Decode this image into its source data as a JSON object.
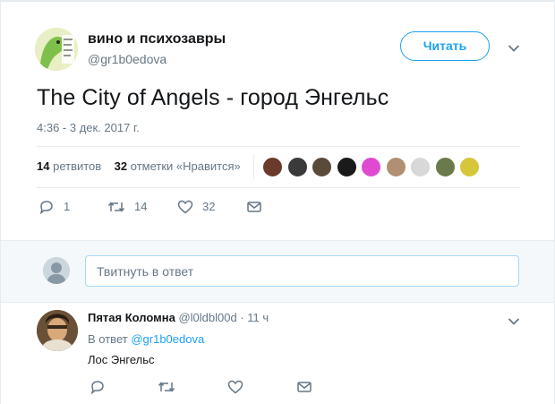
{
  "tweet": {
    "author_name": "вино и психозавры",
    "author_handle": "@gr1b0edova",
    "follow_label": "Читать",
    "text": "The City of Angels - город Энгельс",
    "timestamp": "4:36 - 3 дек. 2017 г.",
    "retweets_count": "14",
    "retweets_label": "ретвитов",
    "likes_count": "32",
    "likes_label": "отметки «Нравится»",
    "actions": {
      "replies": "1",
      "retweets": "14",
      "likes": "32"
    },
    "liker_avatar_colors": [
      "#6b3a2a",
      "#3a3a3a",
      "#5a4a3a",
      "#1a1a1a",
      "#e04ad0",
      "#b09070",
      "#d8d8d8",
      "#6a7a4a",
      "#d6c63a"
    ]
  },
  "reply_box": {
    "placeholder": "Твитнуть в ответ"
  },
  "reply": {
    "author_name": "Пятая Коломна",
    "author_handle": "@l0ldbl00d",
    "time": "· 11 ч",
    "in_reply_prefix": "В ответ",
    "in_reply_handle": "@gr1b0edova",
    "text": "Лос Энгельс"
  },
  "colors": {
    "accent": "#1da1f2",
    "muted": "#657786",
    "divider": "#e6ecf0"
  }
}
